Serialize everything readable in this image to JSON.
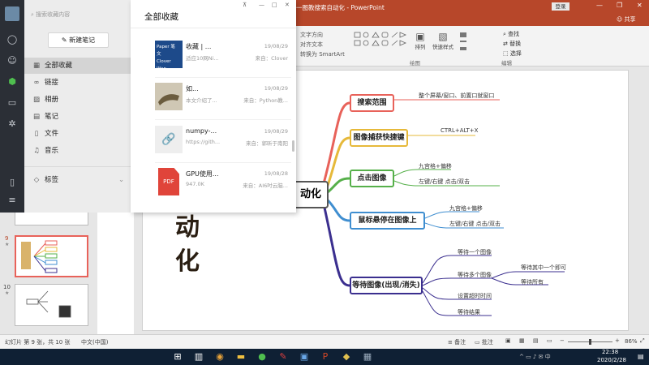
{
  "ppt": {
    "title": "一图教搜索自动化 - PowerPoint",
    "login_label": "登录",
    "share_label": "共享",
    "ribbon": {
      "text_direction": "文字方向",
      "align_text": "对齐文本",
      "smartart": "转换为 SmartArt",
      "arrange": "排列",
      "quick_styles": "快速样式",
      "find": "查找",
      "replace": "替换",
      "select": "选择",
      "group_drawing": "绘图",
      "group_editing": "编辑"
    },
    "slide_numbers": [
      "9",
      "10"
    ],
    "slide_title_chars": [
      "动",
      "化"
    ],
    "mindmap": {
      "root_suffix": "动化",
      "branches": [
        {
          "label": "搜索范围",
          "color": "#e8625a",
          "leaves": [
            "整个屏幕/窗口、前置口就窗口"
          ]
        },
        {
          "label": "图像捕获快捷键",
          "color": "#e6b93a",
          "leaves": [
            "CTRL+ALT+X"
          ]
        },
        {
          "label": "点击图像",
          "color": "#56b04a",
          "leaves": [
            "九宫格+偏移",
            "左键/右键  点击/双击"
          ]
        },
        {
          "label": "鼠标悬停在图像上",
          "color": "#3f8ed0",
          "leaves": [
            "九宫格+偏移",
            "左键/右键  点击/双击"
          ]
        },
        {
          "label": "等待图像(出现/消失)",
          "color": "#3b2f8f",
          "leaves": [
            "等待一个图像",
            "等待多个图像",
            "设置超时时间",
            "等待结果"
          ]
        }
      ],
      "sub_leaves": [
        "等待其中一个即可",
        "等待所有"
      ]
    },
    "status": {
      "slide_info": "幻灯片 第 9 张，共 10 张",
      "language": "中文(中国)",
      "notes": "备注",
      "comments": "批注",
      "zoom": "86%"
    },
    "taskbar": {
      "time": "22:38",
      "date": "2020/2/28"
    }
  },
  "fav": {
    "search_placeholder": "搜索收藏内容",
    "new_note_label": "新建笔记",
    "header": "全部收藏",
    "nav": [
      {
        "label": "全部收藏",
        "icon": "grid-icon"
      },
      {
        "label": "链接",
        "icon": "link-icon"
      },
      {
        "label": "相册",
        "icon": "image-icon"
      },
      {
        "label": "笔记",
        "icon": "note-icon"
      },
      {
        "label": "文件",
        "icon": "file-icon"
      },
      {
        "label": "音乐",
        "icon": "music-icon"
      }
    ],
    "tags_label": "标签",
    "items": [
      {
        "title": "收藏 | ...",
        "date": "19/08/29",
        "desc": "适应10网Ni...",
        "source": "来自：Clover"
      },
      {
        "title": "如...",
        "date": "19/08/29",
        "desc": "本文介绍了...",
        "source": "来自：Python教..."
      },
      {
        "title": "numpy-...",
        "date": "19/08/29",
        "desc": "https://gith...",
        "source": "来自：郭昕于南阳"
      },
      {
        "title": "GPU使用...",
        "date": "19/08/28",
        "desc": "947.0K",
        "source": "来自：AI6吋云脑..."
      }
    ],
    "thumb_text": [
      "Paper 笔 文",
      "Clover Wan"
    ]
  }
}
